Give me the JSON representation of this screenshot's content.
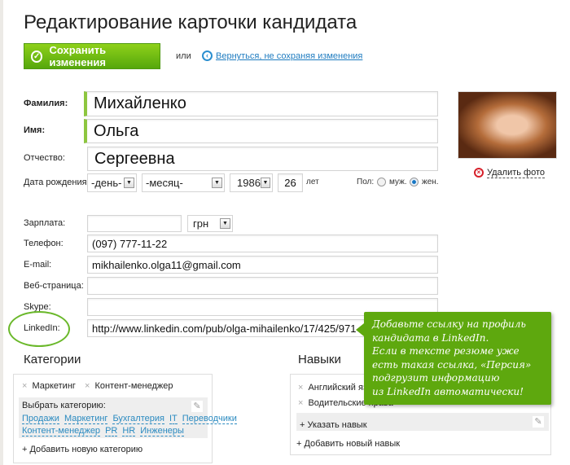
{
  "title": "Редактирование карточки кандидата",
  "save_label": "Сохранить изменения",
  "or": "или",
  "back_label": "Вернуться, не сохраняя изменения",
  "fields": {
    "last_name": {
      "label": "Фамилия:",
      "value": "Михайленко"
    },
    "first_name": {
      "label": "Имя:",
      "value": "Ольга"
    },
    "middle_name": {
      "label": "Отчество:",
      "value": "Сергеевна"
    },
    "birth": {
      "label": "Дата рождения:",
      "day": "-день-",
      "month": "-месяц-",
      "year": "1986",
      "age": "26",
      "age_unit": "лет"
    },
    "gender": {
      "label": "Пол:",
      "male": "муж.",
      "female": "жен.",
      "selected": "жен."
    },
    "salary": {
      "label": "Зарплата:",
      "value": "",
      "currency": "грн"
    },
    "phone": {
      "label": "Телефон:",
      "value": "(097) 777-11-22"
    },
    "email": {
      "label": "E-mail:",
      "value": "mikhailenko.olga11@gmail.com"
    },
    "web": {
      "label": "Веб-страница:",
      "value": ""
    },
    "skype": {
      "label": "Skype:",
      "value": ""
    },
    "linkedin": {
      "label": "LinkedIn:",
      "value": "http://www.linkedin.com/pub/olga-mihailenko/17/425/971"
    }
  },
  "delete_photo": "Удалить фото",
  "tooltip": "Добавьте ссылку на профиль\nкандидата в LinkedIn.\nЕсли в тексте резюме уже\nесть такая ссылка, «Персия»\nподгрузит информацию\nиз LinkedIn автоматически!",
  "categories": {
    "heading": "Категории",
    "tags": [
      "Маркетинг",
      "Контент-менеджер"
    ],
    "choose_label": "Выбрать категорию:",
    "options": [
      "Продажи",
      "Маркетинг",
      "Бухгалтерия",
      "IT",
      "Переводчики",
      "Контент-менеджер",
      "PR",
      "HR",
      "Инженеры"
    ],
    "add_label": "+ Добавить новую категорию"
  },
  "skills": {
    "heading": "Навыки",
    "tags": [
      "Английский язык",
      "Водительские права"
    ],
    "specify_label": "+ Указать навык",
    "add_label": "+ Добавить новый навык"
  }
}
